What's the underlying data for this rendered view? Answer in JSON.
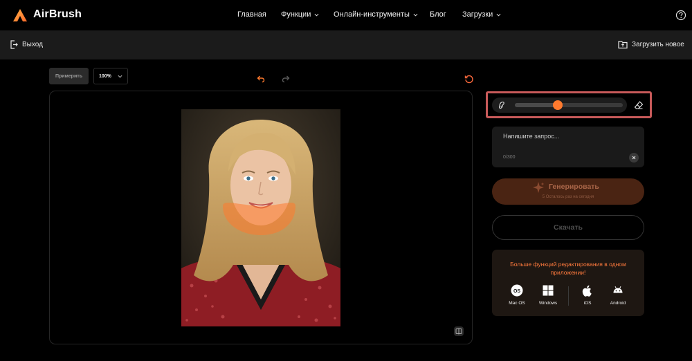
{
  "app": {
    "brand": "AirBrush"
  },
  "nav": {
    "items": [
      {
        "label": "Главная",
        "has_dropdown": false
      },
      {
        "label": "Функции",
        "has_dropdown": true
      },
      {
        "label": "Онлайн-инструменты",
        "has_dropdown": true
      },
      {
        "label": "Блог",
        "has_dropdown": false
      },
      {
        "label": "Загрузки",
        "has_dropdown": true
      }
    ]
  },
  "subbar": {
    "exit_label": "Выход",
    "upload_label": "Загрузить новое"
  },
  "toolbar": {
    "try_label": "Примерить",
    "zoom_value": "100%"
  },
  "brush": {
    "size_fraction": 0.4
  },
  "prompt": {
    "placeholder": "Напишите запрос...",
    "counter": "0/300"
  },
  "generate": {
    "label": "Генерировать",
    "credits_note": "5 Осталось раз на сегодня"
  },
  "download": {
    "label": "Скачать"
  },
  "promo": {
    "text": "Больше функций редактирования в одном приложении!",
    "platforms": [
      {
        "label": "Mac OS",
        "icon": "macos-icon"
      },
      {
        "label": "Windows",
        "icon": "windows-icon"
      },
      {
        "label": "iOS",
        "icon": "apple-icon"
      },
      {
        "label": "Android",
        "icon": "android-icon"
      }
    ]
  },
  "colors": {
    "accent": "#ff7a2e",
    "highlight_border": "#c85a5a",
    "generate_bg": "#4a2413"
  }
}
